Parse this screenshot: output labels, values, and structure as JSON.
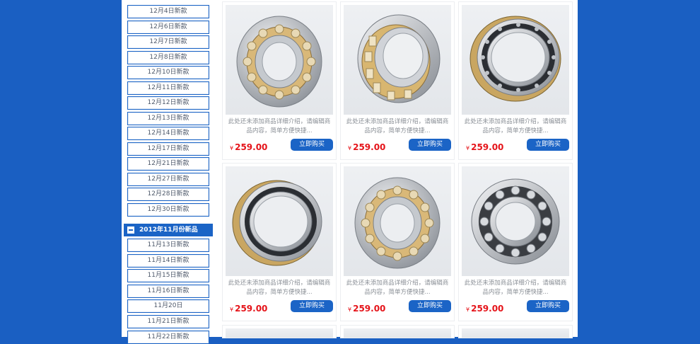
{
  "sidebar": {
    "dec_items": [
      "12月4日新款",
      "12月6日新款",
      "12月7日新款",
      "12月8日新款",
      "12月10日新款",
      "12月11日新款",
      "12月12日新款",
      "12月13日新款",
      "12月14日新款",
      "12月17日新款",
      "12月21日新款",
      "12月27日新款",
      "12月28日新款",
      "12月30日新款"
    ],
    "nov_heading": "2012年11月份新品",
    "nov_items": [
      "11月13日新款",
      "11月14日新款",
      "11月15日新款",
      "11月16日新款",
      "11月20日",
      "11月21日新款",
      "11月22日新款"
    ]
  },
  "products": [
    {
      "desc": "此处还未添加商品详细介绍，请编辑商品内容，简单方便快捷...",
      "currency": "¥",
      "price": "259.00",
      "buy": "立即购买",
      "image": "spherical-roller-bearing"
    },
    {
      "desc": "此处还未添加商品详细介绍，请编辑商品内容，简单方便快捷...",
      "currency": "¥",
      "price": "259.00",
      "buy": "立即购买",
      "image": "tapered-roller-bearing"
    },
    {
      "desc": "此处还未添加商品详细介绍，请编辑商品内容，简单方便快捷...",
      "currency": "¥",
      "price": "259.00",
      "buy": "立即购买",
      "image": "deep-groove-bearing"
    },
    {
      "desc": "此处还未添加商品详细介绍，请编辑商品内容，简单方便快捷...",
      "currency": "¥",
      "price": "259.00",
      "buy": "立即购买",
      "image": "deep-groove-bearing"
    },
    {
      "desc": "此处还未添加商品详细介绍，请编辑商品内容，简单方便快捷...",
      "currency": "¥",
      "price": "259.00",
      "buy": "立即购买",
      "image": "spherical-roller-bearing"
    },
    {
      "desc": "此处还未添加商品详细介绍，请编辑商品内容，简单方便快捷...",
      "currency": "¥",
      "price": "259.00",
      "buy": "立即购买",
      "image": "ball-bearing"
    }
  ]
}
